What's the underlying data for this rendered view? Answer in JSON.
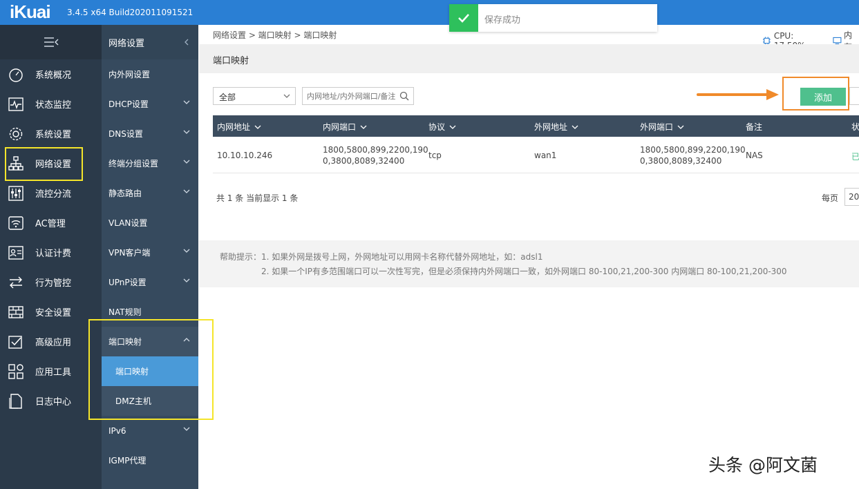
{
  "app": {
    "logo": "iKuai",
    "version": "3.4.5 x64 Build202011091521"
  },
  "toast": {
    "message": "保存成功"
  },
  "sidebar": {
    "items": [
      {
        "label": "系统概况",
        "icon": "gauge-icon"
      },
      {
        "label": "状态监控",
        "icon": "pulse-icon"
      },
      {
        "label": "系统设置",
        "icon": "gear-icon"
      },
      {
        "label": "网络设置",
        "icon": "network-icon",
        "active": true
      },
      {
        "label": "流控分流",
        "icon": "sliders-icon"
      },
      {
        "label": "AC管理",
        "icon": "wifi-icon"
      },
      {
        "label": "认证计费",
        "icon": "id-card-icon"
      },
      {
        "label": "行为管控",
        "icon": "arrows-icon"
      },
      {
        "label": "安全设置",
        "icon": "firewall-icon"
      },
      {
        "label": "高级应用",
        "icon": "checkbox-icon"
      },
      {
        "label": "应用工具",
        "icon": "grid-icon"
      },
      {
        "label": "日志中心",
        "icon": "document-icon"
      }
    ]
  },
  "subnav": {
    "title": "网络设置",
    "items": [
      {
        "label": "内外网设置",
        "chevron": false
      },
      {
        "label": "DHCP设置",
        "chevron": true
      },
      {
        "label": "DNS设置",
        "chevron": true
      },
      {
        "label": "终端分组设置",
        "chevron": true
      },
      {
        "label": "静态路由",
        "chevron": true
      },
      {
        "label": "VLAN设置",
        "chevron": false
      },
      {
        "label": "VPN客户端",
        "chevron": true
      },
      {
        "label": "UPnP设置",
        "chevron": true
      },
      {
        "label": "NAT规则",
        "chevron": false
      },
      {
        "label": "端口映射",
        "chevron": "up"
      },
      {
        "label": "端口映射",
        "sub": true,
        "active": true
      },
      {
        "label": "DMZ主机",
        "sub": true
      },
      {
        "label": "IPv6",
        "chevron": true
      },
      {
        "label": "IGMP代理",
        "chevron": false
      }
    ]
  },
  "breadcrumb": "网络设置 > 端口映射 > 端口映射",
  "status": {
    "cpu": "CPU: 17.50%",
    "mem": "内存"
  },
  "page": {
    "title": "端口映射"
  },
  "filter": {
    "selected": "全部",
    "search_placeholder": "内网地址/内外网端口/备注"
  },
  "toolbar": {
    "add_label": "添加"
  },
  "table": {
    "headers": [
      "内网地址",
      "内网端口",
      "协议",
      "外网地址",
      "外网端口",
      "备注",
      "状"
    ],
    "rows": [
      {
        "lan_addr": "10.10.10.246",
        "lan_port_1": "1800,5800,899,2200,190",
        "lan_port_2": "0,3800,8089,32400",
        "protocol": "tcp",
        "wan_addr": "wan1",
        "wan_port_1": "1800,5800,899,2200,190",
        "wan_port_2": "0,3800,8089,32400",
        "remark": "NAS",
        "status": "已"
      }
    ]
  },
  "pagination": {
    "summary": "共 1 条 当前显示 1 条",
    "per_page_label": "每页",
    "per_page_value": "20"
  },
  "help": {
    "line1": "帮助提示：1. 如果外网是拨号上网，外网地址可以用网卡名称代替外网地址，如：adsl1",
    "line2": "2. 如果一个IP有多范围端口可以一次性写完，但是必须保持内外网端口一致，如外网端口 80-100,21,200-300 内网端口 80-100,21,200-300"
  },
  "watermark": "头条 @阿文菌",
  "colors": {
    "topbar": "#2a7fd4",
    "sidebar": "#2b3a4a",
    "subnav": "#364a5e",
    "accent": "#4a9ad8",
    "add_button": "#4fc08d",
    "highlight_yellow": "#f5e52a",
    "highlight_orange": "#f08a2a"
  }
}
